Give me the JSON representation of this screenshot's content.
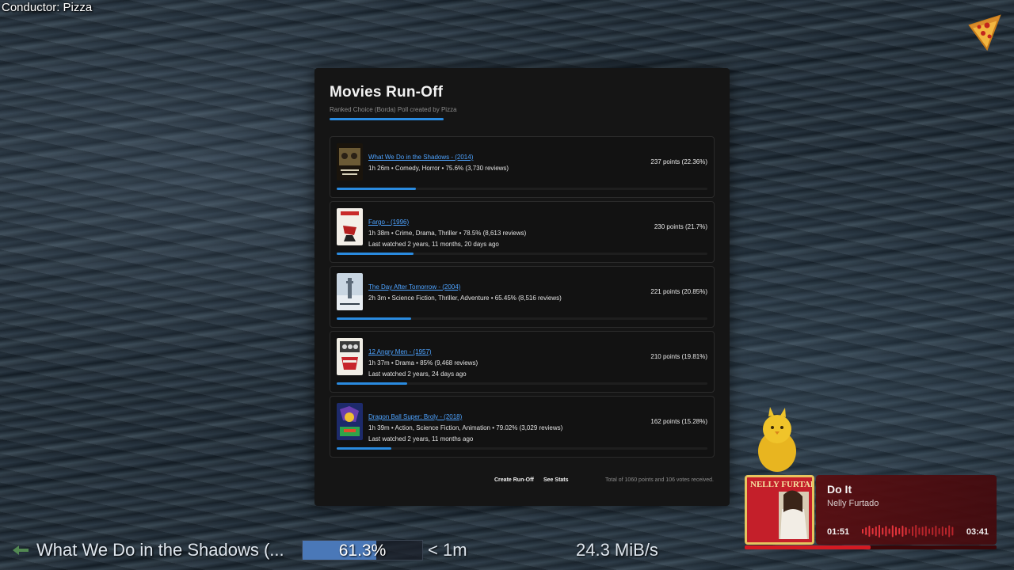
{
  "overlay": {
    "conductor": "Conductor: Pizza"
  },
  "poll": {
    "title": "Movies Run-Off",
    "subtitle": "Ranked Choice (Borda) Poll created by Pizza",
    "entries": [
      {
        "title": "What We Do in the Shadows - (2014)",
        "meta": "1h 26m • Comedy, Horror • 75.6% (3,730 reviews)",
        "watched": "",
        "points": "237 points (22.36%)",
        "share": 22.36
      },
      {
        "title": "Fargo - (1996)",
        "meta": "1h 38m • Crime, Drama, Thriller • 78.5% (8,613 reviews)",
        "watched": "Last watched 2 years, 11 months, 20 days ago",
        "points": "230 points (21.7%)",
        "share": 21.7
      },
      {
        "title": "The Day After Tomorrow - (2004)",
        "meta": "2h 3m • Science Fiction, Thriller, Adventure • 65.45% (8,516 reviews)",
        "watched": "",
        "points": "221 points (20.85%)",
        "share": 20.85
      },
      {
        "title": "12 Angry Men - (1957)",
        "meta": "1h 37m • Drama • 85% (9,468 reviews)",
        "watched": "Last watched 2 years, 24 days ago",
        "points": "210 points (19.81%)",
        "share": 19.81
      },
      {
        "title": "Dragon Ball Super: Broly - (2018)",
        "meta": "1h 39m • Action, Science Fiction, Animation • 79.02% (3,029 reviews)",
        "watched": "Last watched 2 years, 11 months ago",
        "points": "162 points (15.28%)",
        "share": 15.28
      }
    ],
    "create_label": "Create Run-Off",
    "stats_label": "See Stats",
    "total": "Total of 1060 points and 106 votes received.",
    "accent": "#2a8be0"
  },
  "download": {
    "title": "What We Do in the Shadows (...",
    "percent_label": "61.3%",
    "percent": 61.3,
    "eta": "< 1m",
    "speed": "24.3 MiB/s"
  },
  "player": {
    "song": "Do It",
    "artist": "Nelly Furtado",
    "album_text": "NELLY FURTADO",
    "elapsed": "01:51",
    "duration": "03:41",
    "progress": 0.5,
    "accent": "#d31a22"
  }
}
